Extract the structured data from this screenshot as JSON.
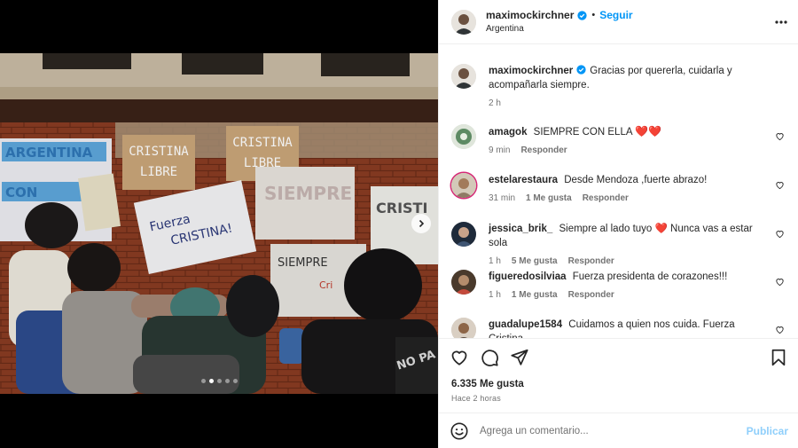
{
  "post": {
    "author": {
      "username": "maximockirchner",
      "verified": true,
      "location": "Argentina",
      "follow_label": "Seguir",
      "separator": "•"
    },
    "photo": {
      "signs": [
        "CRISTINA LIBRE",
        "CRISTINA LIBRE",
        "SIEMPRE JUNTO A VOS",
        "Fuerza CRISTINA!",
        "SIEMPRE JUNTO A CRI",
        "CRISTI"
      ],
      "carousel": {
        "count": 5,
        "active_index": 1
      }
    },
    "caption": {
      "username": "maximockirchner",
      "text": "Gracias por quererla, cuidarla y acompañarla siempre.",
      "time": "2 h"
    },
    "comments": [
      {
        "username": "amagok",
        "text": "SIEMPRE CON ELLA",
        "emoji": "❤️❤️",
        "time": "9 min",
        "likes": "",
        "reply": "Responder"
      },
      {
        "username": "estelarestaura",
        "text": "Desde Mendoza ,fuerte abrazo!",
        "time": "31 min",
        "likes": "1 Me gusta",
        "reply": "Responder"
      },
      {
        "username": "jessica_brik_",
        "text": "Siempre al lado tuyo ❤️ Nunca vas a estar sola",
        "time": "1 h",
        "likes": "5 Me gusta",
        "reply": "Responder"
      },
      {
        "username": "figueredosilviaa",
        "text": "Fuerza presidenta de corazones!!!",
        "time": "1 h",
        "likes": "1 Me gusta",
        "reply": "Responder"
      },
      {
        "username": "guadalupe1584",
        "text": "Cuidamos a quien nos cuida. Fuerza Cristina.",
        "time": "",
        "likes": "",
        "reply": ""
      }
    ],
    "likes": "6.335 Me gusta",
    "posted": "Hace 2 horas",
    "add_comment": {
      "placeholder": "Agrega un comentario...",
      "publish_label": "Publicar"
    },
    "icons": {
      "like": "heart-outline-icon",
      "comment": "speech-bubble-icon",
      "share": "paper-plane-icon",
      "save": "bookmark-icon",
      "emoji": "smiley-icon",
      "more": "ellipsis-icon",
      "verified": "verified-badge-icon"
    },
    "colors": {
      "accent": "#0095f6",
      "publish_disabled": "#8fcffb",
      "heart": "#ed4956",
      "muted": "#737373"
    }
  }
}
